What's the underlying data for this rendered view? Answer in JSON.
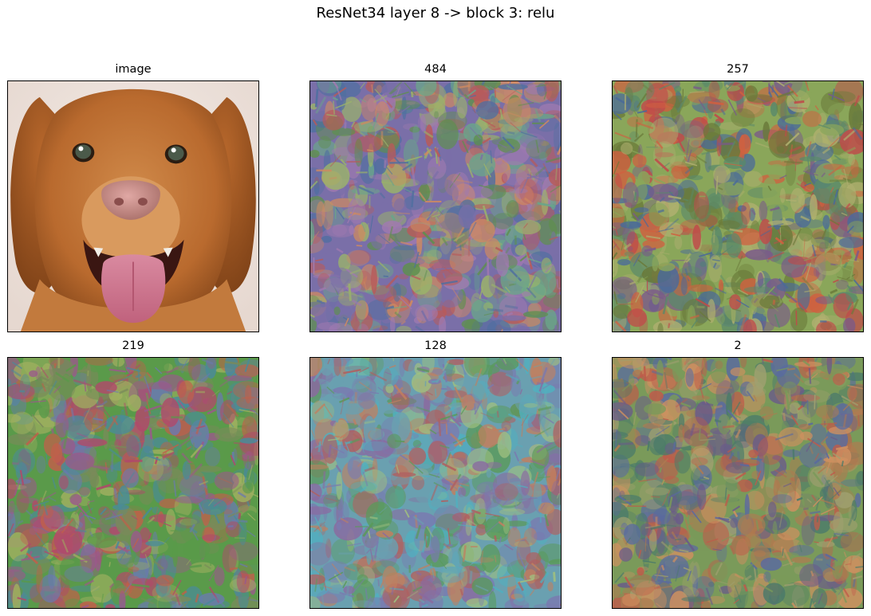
{
  "figure": {
    "title": "ResNet34 layer 8 -> block 3: relu"
  },
  "panels": [
    {
      "title": "image",
      "kind": "photo",
      "subject": "dog face"
    },
    {
      "title": "484",
      "kind": "feature-visualization"
    },
    {
      "title": "257",
      "kind": "feature-visualization"
    },
    {
      "title": "219",
      "kind": "feature-visualization"
    },
    {
      "title": "128",
      "kind": "feature-visualization"
    },
    {
      "title": "2",
      "kind": "feature-visualization"
    }
  ]
}
